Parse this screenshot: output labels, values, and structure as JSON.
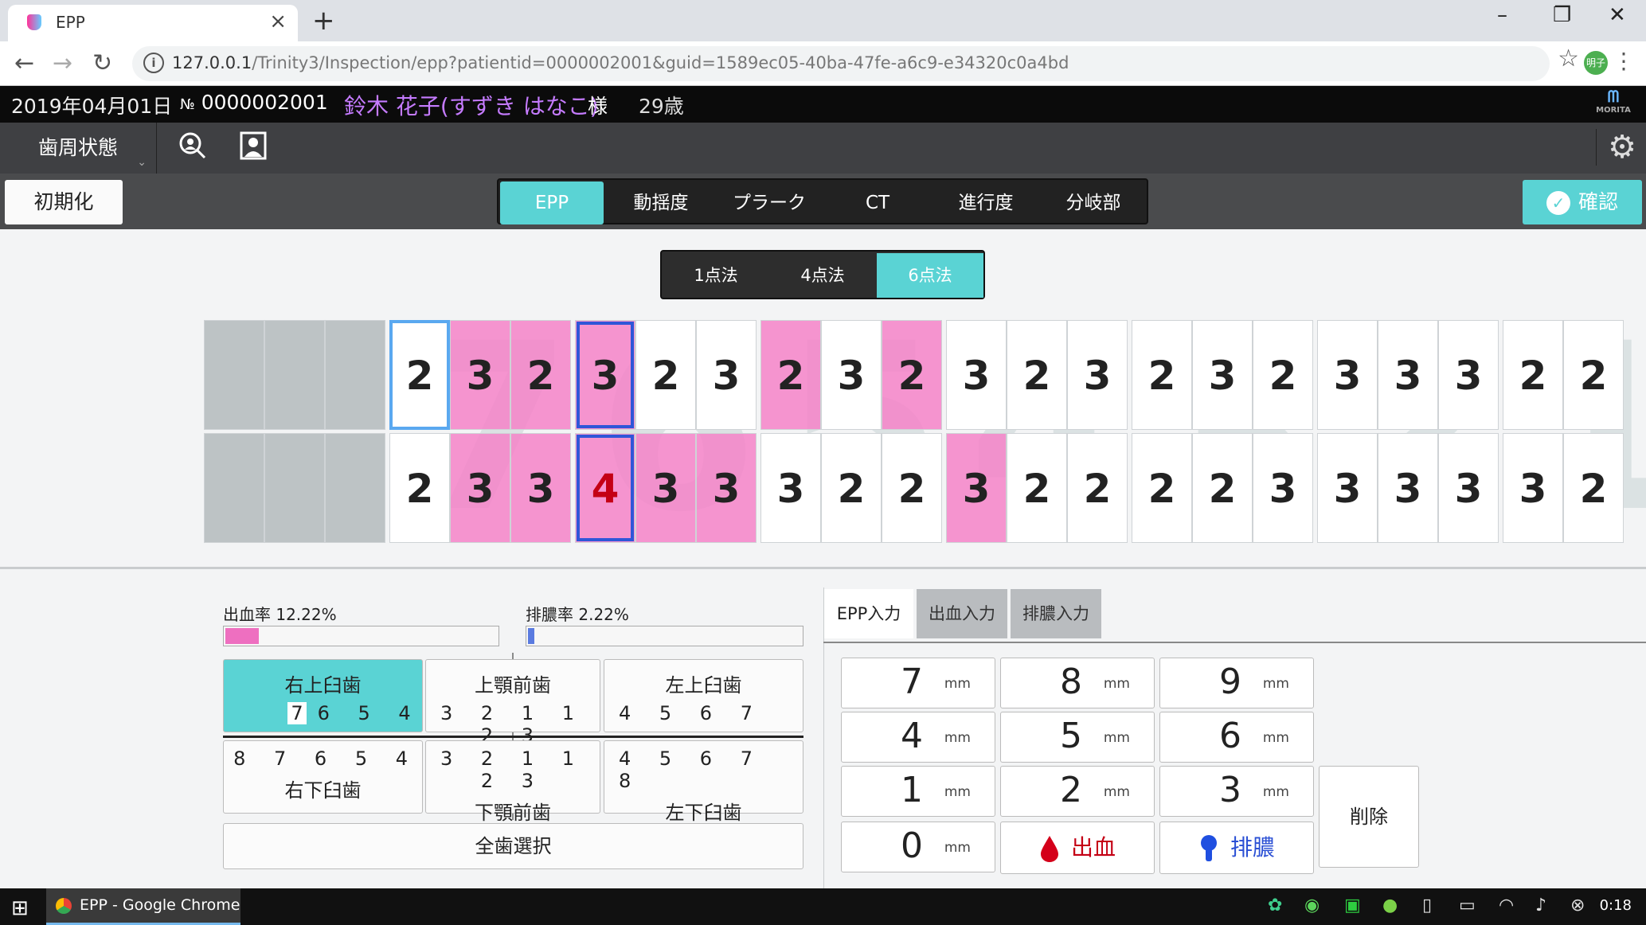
{
  "browser": {
    "tab_title": "EPP",
    "tab_close": "×",
    "new_tab": "+",
    "window_min": "–",
    "window_restore": "❐",
    "window_close": "✕",
    "back": "←",
    "forward": "→",
    "reload": "↻",
    "url_host": "127.0.0.1",
    "url_path": "/Trinity3/Inspection/epp?patientid=0000002001&guid=1589ec05-40ba-47fe-a6c9-e34320c0a4bd",
    "profile": "明子",
    "star": "☆",
    "menu": "⋮"
  },
  "patient": {
    "date": "2019年04月01日",
    "no_label": "№",
    "no": "0000002001",
    "name": "鈴木 花子(すずき はなこ)",
    "honorific": "様",
    "age": "29歳",
    "logo": "MORITA"
  },
  "header": {
    "mode": "歯周状態",
    "settings_icon": "⚙"
  },
  "toolbar": {
    "reset": "初期化",
    "tabs": [
      "EPP",
      "動揺度",
      "プラーク",
      "CT",
      "進行度",
      "分岐部"
    ],
    "active_tab": "EPP",
    "confirm": "確認",
    "confirm_check": "✓"
  },
  "method": {
    "options": [
      "1点法",
      "4点法",
      "6点法"
    ],
    "active": "6点法"
  },
  "chart": {
    "tooth_numbers": [
      "7",
      "6",
      "5",
      "4",
      "3",
      "2",
      "1"
    ],
    "upper_row": [
      "",
      "",
      "",
      "2",
      "3",
      "2",
      "3",
      "2",
      "3",
      "2",
      "3",
      "2",
      "3",
      "2",
      "3",
      "2",
      "3",
      "2",
      "3",
      "3",
      "3",
      "2",
      "2"
    ],
    "lower_row": [
      "",
      "",
      "",
      "2",
      "3",
      "3",
      "4",
      "3",
      "3",
      "3",
      "2",
      "2",
      "3",
      "2",
      "2",
      "2",
      "2",
      "3",
      "3",
      "3",
      "3",
      "3",
      "2"
    ],
    "upper_pink": [
      4,
      5,
      6,
      9,
      11
    ],
    "lower_pink": [
      4,
      5,
      6,
      7,
      8,
      12
    ],
    "bleeding_value_color": "#c40015",
    "pink_color": "#f582c8"
  },
  "rates": {
    "bleeding_label": "出血率",
    "bleeding_value": "12.22%",
    "bleeding_fraction": 0.1222,
    "pus_label": "排膿率",
    "pus_value": "2.22%",
    "pus_fraction": 0.0222
  },
  "quadrants": {
    "upper_right": {
      "label": "右上臼歯",
      "nums_sel": "7",
      "nums": "6 5 4"
    },
    "upper_front": {
      "label": "上顎前歯",
      "nums": "3 2 1 1 2 3"
    },
    "upper_left": {
      "label": "左上臼歯",
      "nums": "4 5 6 7"
    },
    "lower_right": {
      "label": "右下臼歯",
      "nums": "8 7 6 5 4"
    },
    "lower_front": {
      "label": "下顎前歯",
      "nums": "3 2 1 1 2 3"
    },
    "lower_left": {
      "label": "左下臼歯",
      "nums": "4 5 6 7 8"
    },
    "all": "全歯選択"
  },
  "input_tabs": [
    "EPP入力",
    "出血入力",
    "排膿入力"
  ],
  "keypad": {
    "unit": "mm",
    "keys": [
      "7",
      "8",
      "9",
      "4",
      "5",
      "6",
      "1",
      "2",
      "3",
      "0"
    ],
    "bleeding": "出血",
    "pus": "排膿",
    "delete": "削除"
  },
  "taskbar": {
    "start": "⊞",
    "task": "EPP - Google Chrome",
    "clock": "0:18"
  }
}
